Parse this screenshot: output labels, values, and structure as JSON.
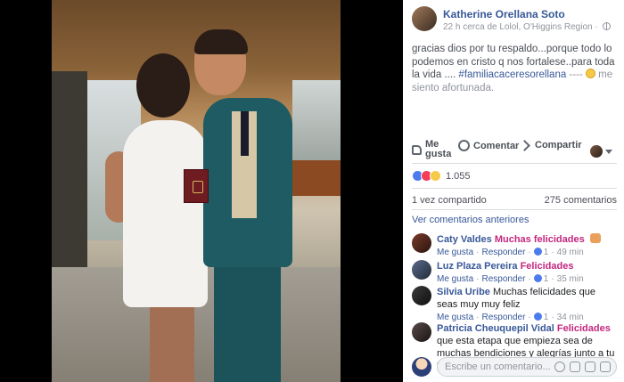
{
  "post": {
    "author": "Katherine Orellana Soto",
    "meta_time": "22 h cerca de Lolol, O'Higgins Region",
    "meta_separator": "·",
    "caption_text": "gracias dios por tu respaldo...porque todo lo podemos en cristo q nos fortalese..para toda la vida .... ",
    "caption_hashtag": "#familiacaceresorellana",
    "caption_dashes": " ---- ",
    "caption_tail": " me siento afortunada."
  },
  "actions": {
    "like_label": "Me gusta",
    "comment_label": "Comentar",
    "share_label": "Compartir"
  },
  "stats": {
    "reaction_count": "1.055",
    "shares": "1 vez compartido",
    "comments_count": "275 comentarios"
  },
  "comments_section": {
    "previous_label": "Ver comentarios anteriores",
    "like_label": "Me gusta",
    "reply_label": "Responder",
    "items": [
      {
        "name": "Caty Valdes",
        "text": "Muchas felicidades",
        "text_style": "pink",
        "likes": "1",
        "time": "49 min"
      },
      {
        "name": "Luz Plaza Pereira",
        "text": "Felicidades",
        "text_style": "pink",
        "likes": "1",
        "time": "35 min"
      },
      {
        "name": "Silvia Uribe",
        "text": "Muchas felicidades que seas muy muy feliz",
        "text_style": "normal",
        "likes": "1",
        "time": "34 min"
      },
      {
        "name": "Patricia Cheuquepil Vidal",
        "text_pink": "Felicidades",
        "text": " que esta etapa que empieza sea de muchas bendiciones y alegrías junto a tu familia"
      }
    ]
  },
  "composer": {
    "placeholder": "Escribe un comentario..."
  },
  "icons": [
    "globe-icon",
    "thumb-icon",
    "comment-icon",
    "share-icon",
    "caret-icon",
    "like-react-icon",
    "love-react-icon",
    "haha-react-icon",
    "mini-like-icon",
    "emoji-pick-icon",
    "camera-icon",
    "gif-icon",
    "sticker-icon"
  ],
  "colors": {
    "link": "#385898",
    "pink_text": "#c3277f",
    "muted": "#90949c",
    "background": "#000000"
  }
}
